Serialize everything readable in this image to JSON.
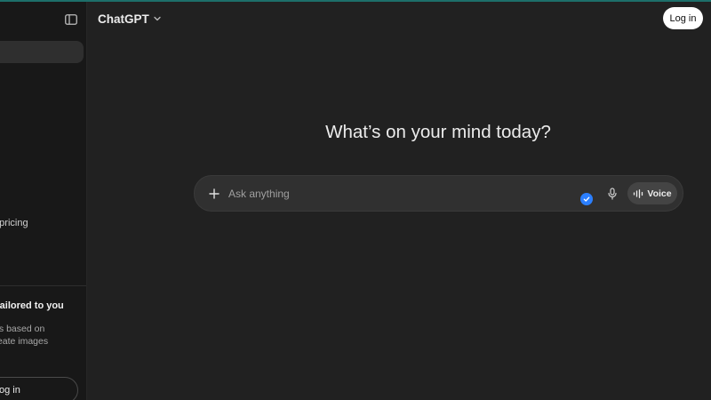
{
  "header": {
    "model_name": "ChatGPT",
    "login_label": "Log in"
  },
  "sidebar": {
    "partial_text": "d pricing",
    "promo": {
      "title": "tailored to you",
      "line1": "wers based on",
      "line2": "s create images",
      "login_label": "og in"
    }
  },
  "main": {
    "headline": "What’s on your mind today?",
    "composer": {
      "placeholder": "Ask anything",
      "voice_label": "Voice"
    }
  },
  "icons": {
    "sidebar_toggle": "sidebar-toggle-icon",
    "chevron": "chevron-down-icon",
    "plus": "plus-icon",
    "check": "check-badge-icon",
    "mic": "microphone-icon",
    "voice": "voice-waveform-icon"
  },
  "colors": {
    "background": "#212121",
    "sidebar": "#181818",
    "composer": "#303030",
    "accent_blue": "#2b7fff",
    "top_accent": "#1d6f6a"
  }
}
